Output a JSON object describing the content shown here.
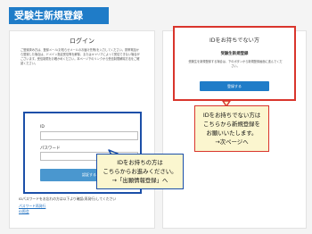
{
  "page": {
    "header_title": "受験生新規登録"
  },
  "login": {
    "title": "ログイン",
    "intro": "ご登録済み方は、登録メール(お知らせメールのお届け先等)を入力してください。携帯電話から登録した場合は、ドメイン指定受信等を解除、またはキャリアによって受信できない場合がございます。受信制限をお確かめください。本ページ下のリンクから受信制限解除方法をご確認ください。",
    "id_label": "ID",
    "password_label": "パスワード",
    "login_button": "認証する",
    "forgot_text": "IDパスワードをお忘れの方は以下より確認(再発行)してください",
    "link_password": "パスワード再発行",
    "link_id": "ID照会"
  },
  "new_registration": {
    "title": "IDをお持ちでない方",
    "subtitle": "受験生新規登録",
    "description": "受験生を新規登録する場合は、下のボタンから新規登録画面に進んでください。",
    "button": "登録する"
  },
  "callouts": {
    "red_line1": "IDをお持ちでない方は",
    "red_line2": "こちらから新規登録を",
    "red_line3": "お願いいたします。",
    "red_line4": "→次ページへ",
    "blue_line1": "IDをお持ちの方は",
    "blue_line2": "こちらからお進みください。",
    "blue_line3": "→「出願情報登録」へ"
  },
  "colors": {
    "header_blue": "#1f7cc8",
    "annotation_red": "#d9352c",
    "annotation_navy": "#1b4fa8",
    "callout_fill": "#fbf6cf"
  }
}
